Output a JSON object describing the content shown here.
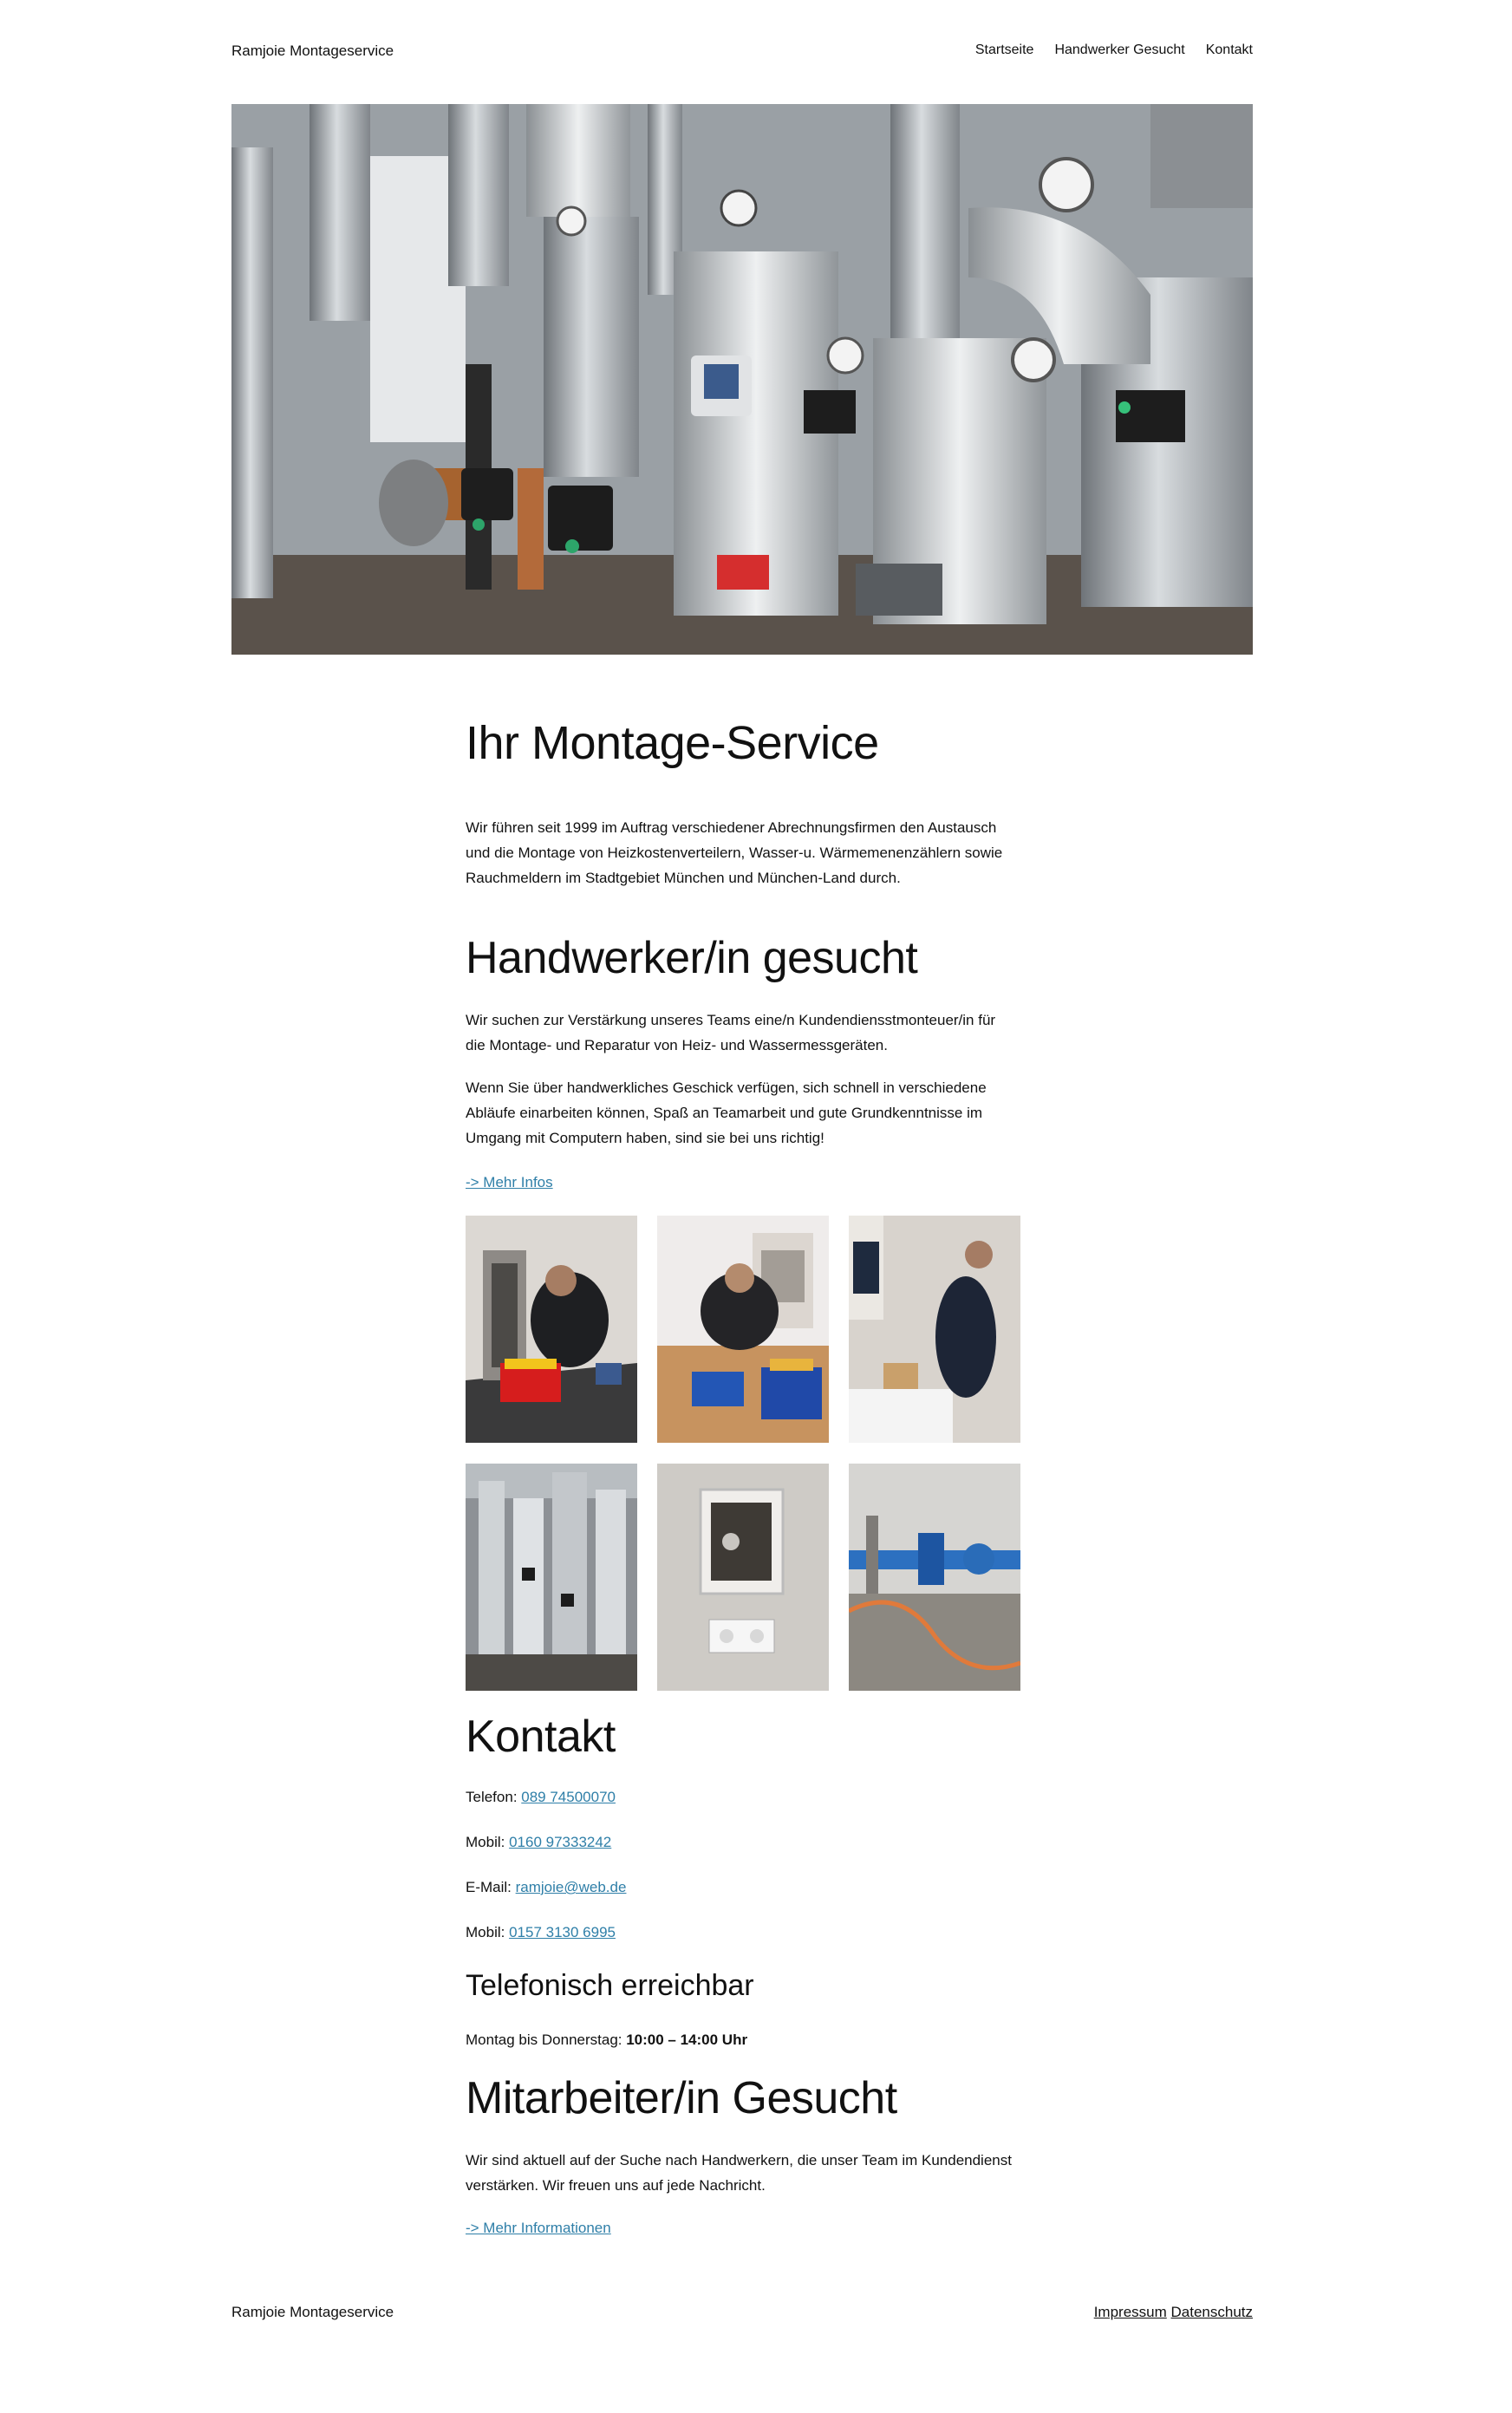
{
  "header": {
    "site_title": "Ramjoie Montageservice",
    "nav": [
      "Startseite",
      "Handwerker Gesucht",
      "Kontakt"
    ]
  },
  "hero": {
    "image": "heating-pipes-boiler-room-photo"
  },
  "intro": {
    "heading": "Ihr Montage-Service",
    "text": "Wir führen seit 1999 im Auftrag verschiedener Abrechnungsfirmen den Austausch und die Montage von Heizkostenverteilern, Wasser-u. Wärmemenenzählern sowie Rauchmeldern im Stadtgebiet München und München-Land durch."
  },
  "jobs": {
    "heading": "Handwerker/in gesucht",
    "text1": "Wir suchen zur Verstärkung unseres Teams eine/n Kundendiensstmonteuer/in für die Montage- und Reparatur von Heiz- und Wassermessgeräten.",
    "text2": "Wenn Sie über handwerkliches Geschick verfügen, sich schnell in verschiedene Abläufe einarbeiten können, Spaß an Teamarbeit und gute Grundkenntnisse im Umgang mit Computern haben, sind sie bei uns richtig!",
    "more_link": "-> Mehr Infos"
  },
  "gallery": [
    "technician-at-floor-manifold-photo",
    "technician-with-toolboxes-photo",
    "technician-in-bathroom-photo",
    "pipe-installation-room-photo",
    "meter-access-panel-photo",
    "blue-water-pipes-photo"
  ],
  "contact": {
    "heading": "Kontakt",
    "rows": [
      {
        "label": "Telefon: ",
        "value": "089 74500070"
      },
      {
        "label": "Mobil: ",
        "value": "0160 97333242"
      },
      {
        "label": "E-Mail: ",
        "value": "ramjoie@web.de"
      },
      {
        "label": "Mobil: ",
        "value": "0157 3130 6995"
      }
    ]
  },
  "hours": {
    "heading": "Telefonisch erreichbar",
    "label": "Montag bis Donnerstag: ",
    "time": "10:00 – 14:00 Uhr"
  },
  "recruit": {
    "heading": "Mitarbeiter/in Gesucht",
    "text": "Wir sind aktuell auf der Suche nach Handwerkern, die unser Team im Kundendienst verstärken. Wir freuen uns auf jede Nachricht.",
    "more_link": "-> Mehr Informationen"
  },
  "footer": {
    "site_title": "Ramjoie Montageservice",
    "links": [
      "Impressum",
      "Datenschutz"
    ]
  }
}
